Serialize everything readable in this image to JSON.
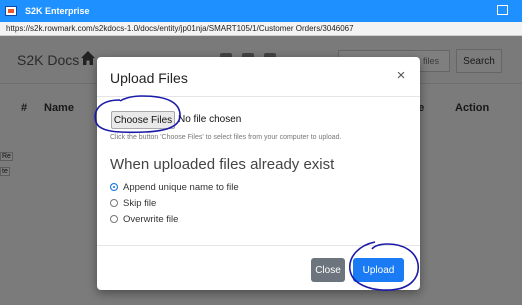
{
  "window": {
    "title": "S2K Enterprise",
    "url": "https://s2k.rowmark.com/s2kdocs-1.0/docs/entity/jp01nja/SMART105/1/Customer Orders/3046067"
  },
  "app": {
    "brand": "S2K Docs",
    "filter_placeholder": "Filter current folder files",
    "search_label": "Search",
    "table_headers": {
      "hash": "#",
      "name": "Name",
      "ce": "ce",
      "action": "Action"
    },
    "left_fragments": [
      "Re",
      "te"
    ]
  },
  "modal": {
    "title": "Upload Files",
    "close_glyph": "×",
    "choose_files_label": "Choose Files",
    "file_status": "No file chosen",
    "hint": "Click the button 'Choose Files' to select files from your computer to upload.",
    "section_title": "When uploaded files already exist",
    "options": [
      {
        "label": "Append unique name to file",
        "selected": true
      },
      {
        "label": "Skip file",
        "selected": false
      },
      {
        "label": "Overwrite file",
        "selected": false
      }
    ],
    "close_label": "Close",
    "upload_label": "Upload"
  },
  "colors": {
    "titlebar": "#1e90ff",
    "upload": "#1a7bf5",
    "close": "#6c757d",
    "annotation": "#1a1aa8"
  }
}
